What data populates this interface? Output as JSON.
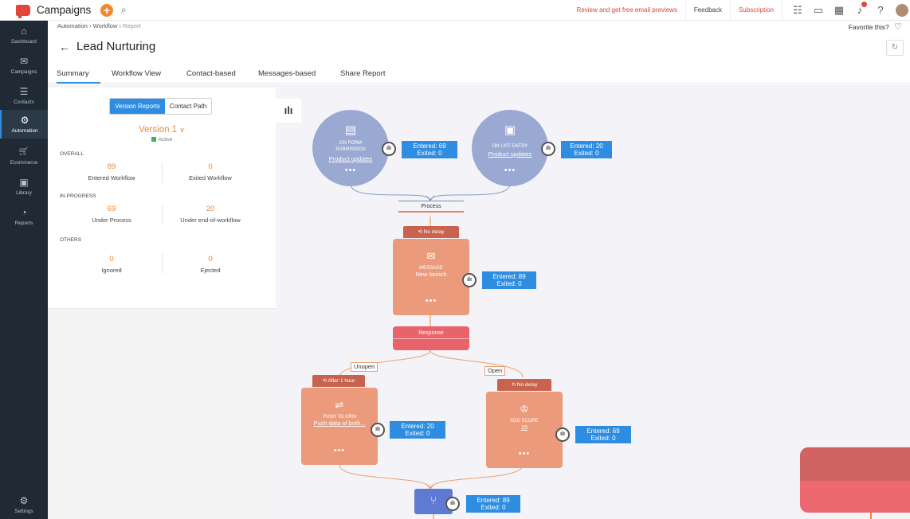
{
  "topbar": {
    "app_name": "Campaigns",
    "plus": "+",
    "search_glyph": "⌕",
    "review_link": "Review and get free email previews",
    "feedback": "Feedback",
    "subscription": "Subscription",
    "icons": [
      "list-settings-icon",
      "folder-icon",
      "calendar-icon",
      "bell-icon",
      "help-icon"
    ]
  },
  "sidebar": {
    "items": [
      {
        "label": "Dashboard",
        "icon": "⌂"
      },
      {
        "label": "Campaigns",
        "icon": "✉"
      },
      {
        "label": "Contacts",
        "icon": "☰"
      },
      {
        "label": "Automation",
        "icon": "⚙"
      },
      {
        "label": "Ecommerce",
        "icon": "🛒"
      },
      {
        "label": "Library",
        "icon": "▣"
      },
      {
        "label": "Reports",
        "icon": "◔"
      },
      {
        "label": "Settings",
        "icon": "⚙"
      }
    ]
  },
  "breadcrumb": {
    "items": [
      "Automation",
      "Workflow",
      "Report"
    ]
  },
  "favorite": "Favorite this?",
  "page": {
    "title": "Lead Nurturing"
  },
  "tabs": [
    "Summary",
    "Workflow View",
    "Contact-based",
    "Messages-based",
    "Share Report"
  ],
  "panel": {
    "toggle": {
      "left": "Version Reports",
      "right": "Contact Path"
    },
    "version": "Version 1",
    "status": "Active",
    "sections": {
      "overall": "OVERALL",
      "in_progress": "IN-PROGRESS",
      "others": "OTHERS"
    },
    "stats": {
      "entered": {
        "value": "89",
        "label": "Entered Workflow"
      },
      "exited": {
        "value": "0",
        "label": "Exited Workflow"
      },
      "under_process": {
        "value": "69",
        "label": "Under Process"
      },
      "under_end": {
        "value": "20",
        "label": "Under end-of-workflow"
      },
      "ignored": {
        "value": "0",
        "label": "Ignored"
      },
      "ejected": {
        "value": "0",
        "label": "Ejected"
      }
    }
  },
  "workflow": {
    "trigger_form": {
      "title_1": "ON FORM",
      "title_2": "SUBMISSION",
      "link": "Product updates",
      "entered": "Entered: 69",
      "exited": "Exited: 0"
    },
    "trigger_list": {
      "title": "ON LIST ENTRY",
      "link": "Product updates",
      "entered": "Entered: 20",
      "exited": "Exited: 0"
    },
    "process": "Process",
    "message_tag": "No delay",
    "message": {
      "title": "MESSAGE",
      "name": "New launch",
      "entered": "Entered: 89",
      "exited": "Exited: 0"
    },
    "response": "Response",
    "branch_unopen": "Unopen",
    "branch_open": "Open",
    "crm_tag": "After 1 hour",
    "crm": {
      "title": "PUSH TO CRM",
      "link": "Push data of both...",
      "entered": "Entered: 20",
      "exited": "Exited: 0"
    },
    "score_tag": "No delay",
    "score": {
      "title": "ADD SCORE",
      "value": "15",
      "entered": "Entered: 69",
      "exited": "Exited: 0"
    },
    "end": {
      "entered": "Entered: 89",
      "exited": "Exited: 0"
    }
  },
  "dots": "•••",
  "stat_glyph": "ılı"
}
